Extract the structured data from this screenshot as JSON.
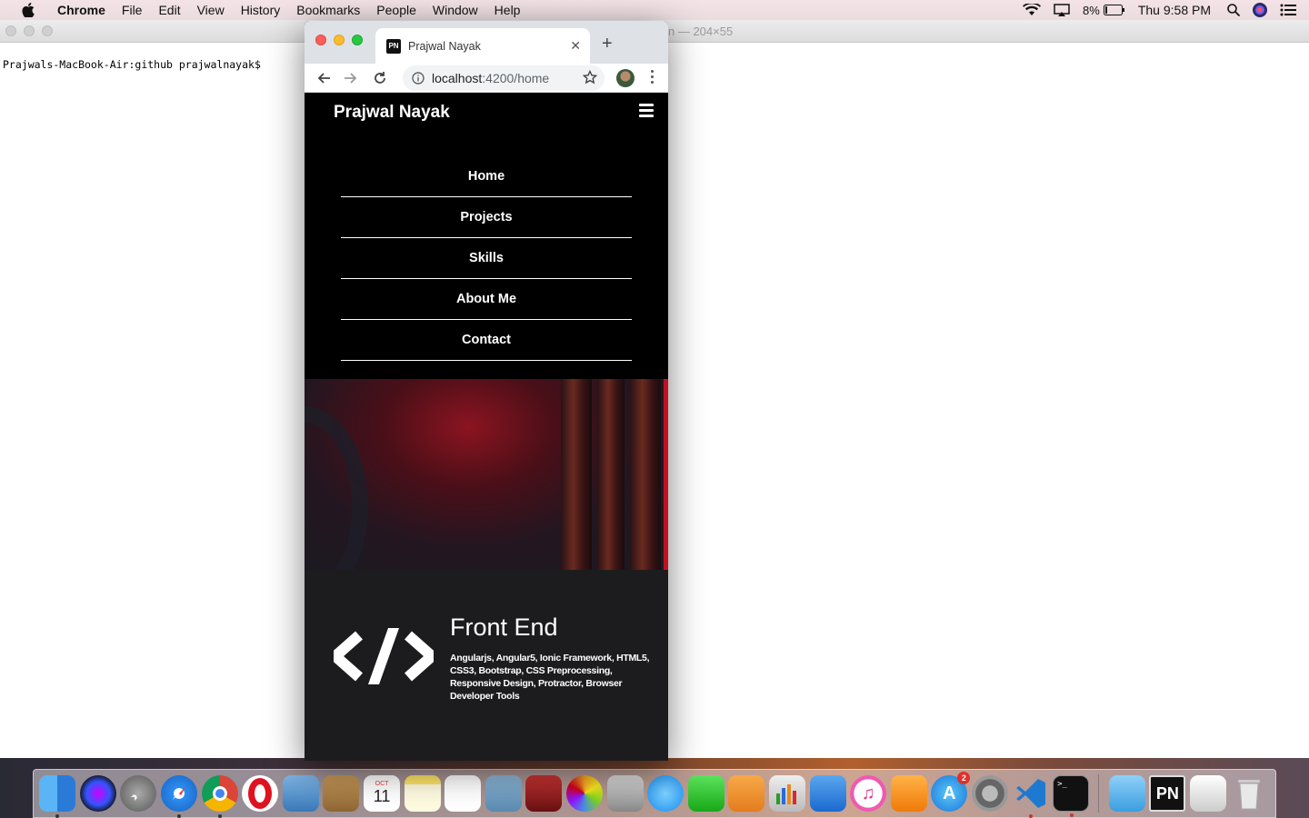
{
  "menubar": {
    "app": "Chrome",
    "items": [
      "File",
      "Edit",
      "View",
      "History",
      "Bookmarks",
      "People",
      "Window",
      "Help"
    ],
    "battery": "8%",
    "clock": "Thu 9:58 PM"
  },
  "terminal": {
    "title": "n — 204×55",
    "prompt": "Prajwals-MacBook-Air:github prajwalnayak$"
  },
  "browser": {
    "tab_title": "Prajwal Nayak",
    "favicon_text": "PN",
    "url_host": "localhost",
    "url_path": ":4200/home"
  },
  "site": {
    "brand": "Prajwal Nayak",
    "nav": [
      {
        "label": "Home"
      },
      {
        "label": "Projects"
      },
      {
        "label": "Skills"
      },
      {
        "label": "About Me"
      },
      {
        "label": "Contact"
      }
    ],
    "skill": {
      "title": "Front End",
      "text": "Angularjs, Angular5, Ionic Framework, HTML5, CSS3, Bootstrap, CSS Preprocessing, Responsive Design, Protractor, Browser Developer Tools"
    }
  },
  "dock": {
    "calendar_month": "OCT",
    "calendar_day": "11",
    "appstore_badge": "2",
    "pn_label": "PN"
  }
}
